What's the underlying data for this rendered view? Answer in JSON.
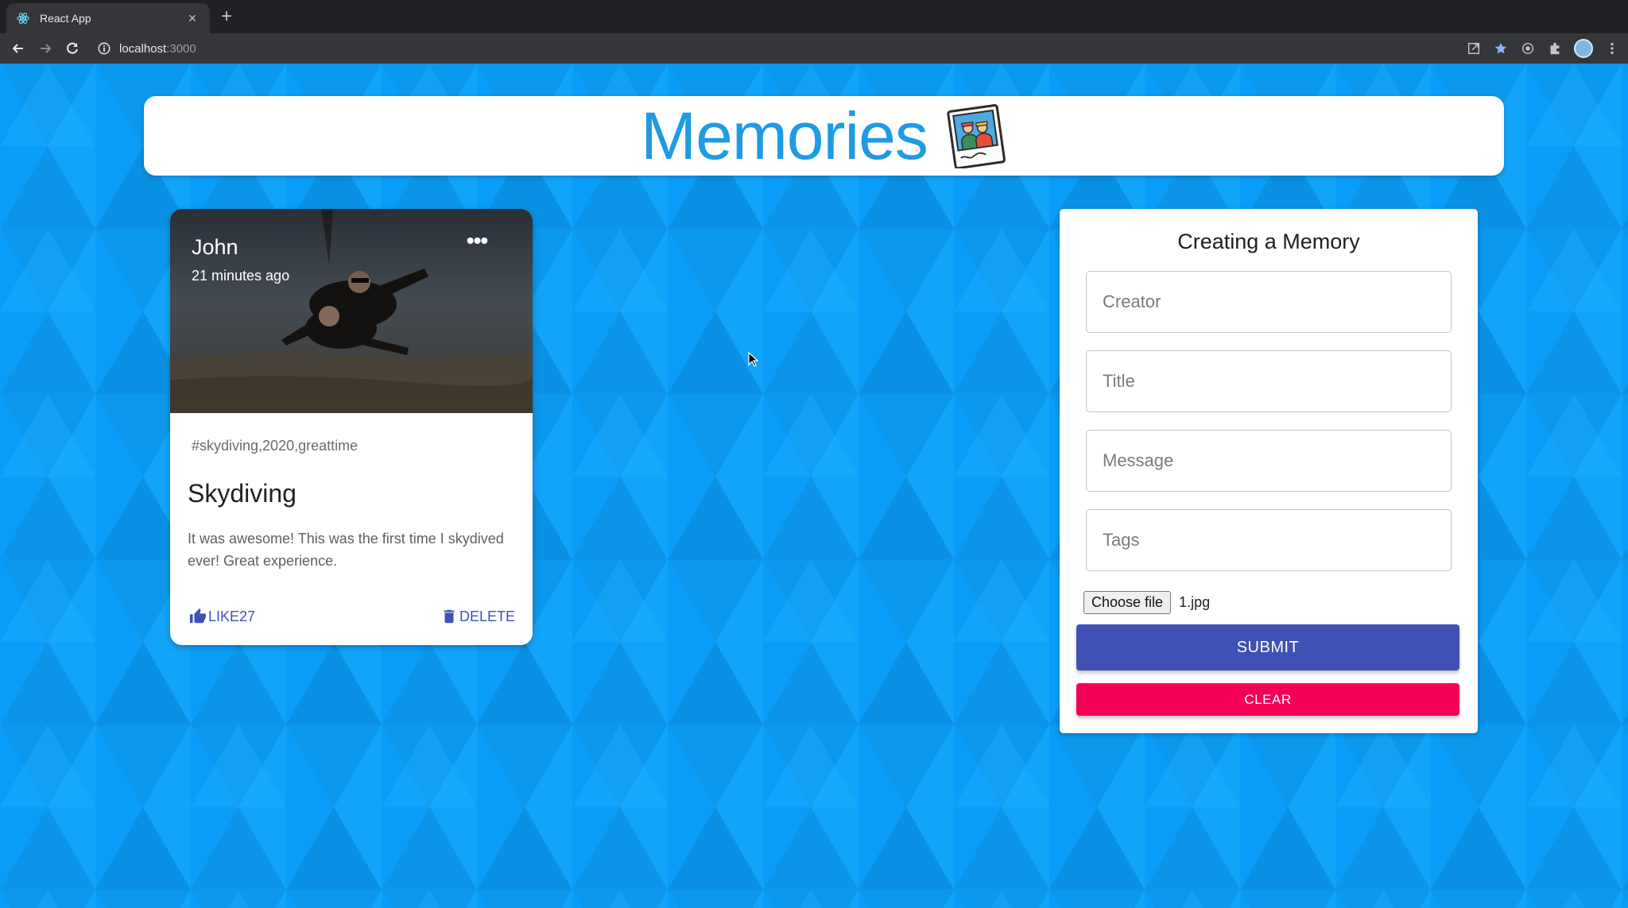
{
  "browser": {
    "tab_title": "React App",
    "tab_close": "×",
    "new_tab": "+",
    "url_host": "localhost",
    "url_port": ":3000"
  },
  "app": {
    "heading": "Memories"
  },
  "post": {
    "creator": "John",
    "time": "21 minutes ago",
    "more": "•••",
    "tags": "#skydiving,2020,greattime",
    "title": "Skydiving",
    "message": "It was awesome! This was the first time I skydived ever! Great experience.",
    "like_label": "LIKE27",
    "delete_label": "DELETE"
  },
  "form": {
    "title": "Creating a Memory",
    "creator_placeholder": "Creator",
    "title_placeholder": "Title",
    "message_placeholder": "Message",
    "tags_placeholder": "Tags",
    "file_button": "Choose file",
    "file_name": "1.jpg",
    "submit_label": "SUBMIT",
    "clear_label": "CLEAR"
  },
  "colors": {
    "page_background": "#0a9df5",
    "heading": "#1f9be3",
    "primary": "#3f51b5",
    "secondary": "#f50057"
  }
}
